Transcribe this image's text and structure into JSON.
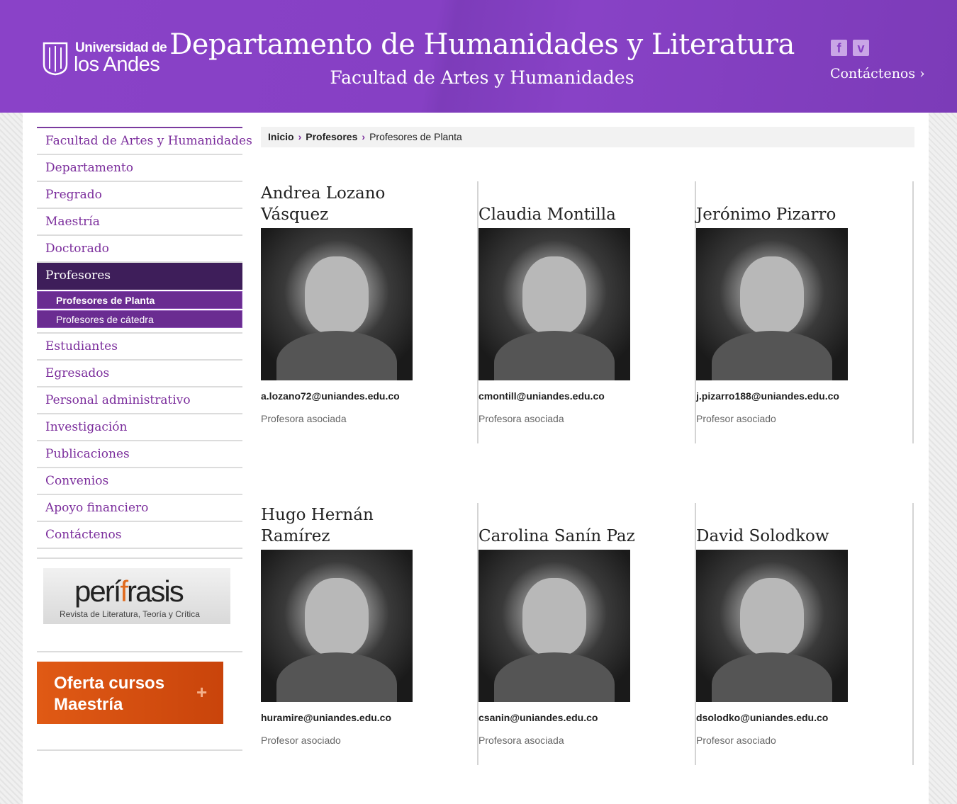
{
  "header": {
    "logo_line1": "Universidad de",
    "logo_line2": "los Andes",
    "title": "Departamento de Humanidades y Literatura",
    "subtitle": "Facultad de Artes y Humanidades",
    "contact_label": "Contáctenos",
    "social": [
      "facebook-icon",
      "vimeo-icon"
    ],
    "accent_color": "#8640c4"
  },
  "sidebar": {
    "items_before": [
      {
        "label": "Facultad de Artes y Humanidades"
      },
      {
        "label": "Departamento"
      },
      {
        "label": "Pregrado"
      },
      {
        "label": "Maestría"
      },
      {
        "label": "Doctorado"
      }
    ],
    "active": {
      "label": "Profesores"
    },
    "subitems": [
      {
        "label": "Profesores de Planta"
      },
      {
        "label": "Profesores de cátedra"
      }
    ],
    "items_after": [
      {
        "label": "Estudiantes"
      },
      {
        "label": "Egresados"
      },
      {
        "label": "Personal administrativo"
      },
      {
        "label": "Investigación"
      },
      {
        "label": "Publicaciones"
      },
      {
        "label": "Convenios"
      },
      {
        "label": "Apoyo financiero"
      },
      {
        "label": "Contáctenos"
      }
    ],
    "banner_perifrasis": {
      "title_a": "perí",
      "title_i": "f",
      "title_b": "rasis",
      "subtitle": "Revista de Literatura, Teoría y Crítica"
    },
    "banner_oferta": {
      "line1": "Oferta cursos",
      "line2": "Maestría",
      "plus": "+"
    }
  },
  "breadcrumb": {
    "home": "Inicio",
    "section": "Profesores",
    "current": "Profesores de Planta",
    "separator": "›"
  },
  "professors": [
    {
      "name": "Andrea Lozano Vásquez",
      "email": "a.lozano72@uniandes.edu.co",
      "role": "Profesora asociada"
    },
    {
      "name": "Claudia Montilla",
      "email": "cmontill@uniandes.edu.co",
      "role": "Profesora asociada"
    },
    {
      "name": "Jerónimo Pizarro",
      "email": "j.pizarro188@uniandes.edu.co",
      "role": "Profesor asociado"
    },
    {
      "name": "Hugo Hernán Ramírez",
      "email": "huramire@uniandes.edu.co",
      "role": "Profesor asociado"
    },
    {
      "name": "Carolina Sanín Paz",
      "email": "csanin@uniandes.edu.co",
      "role": "Profesora asociada"
    },
    {
      "name": "David Solodkow",
      "email": "dsolodko@uniandes.edu.co",
      "role": "Profesor asociado"
    }
  ]
}
